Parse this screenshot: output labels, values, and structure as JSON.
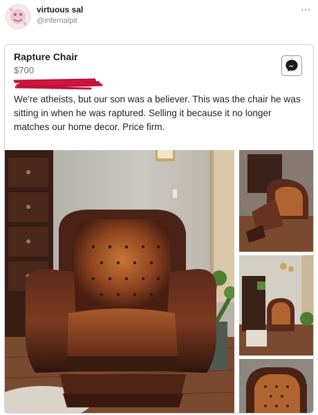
{
  "post": {
    "display_name": "virtuous sal",
    "handle": "@infernalpit",
    "more_icon": "more-horizontal-icon",
    "more_label": "..."
  },
  "listing": {
    "title": "Rapture Chair",
    "price": "$700",
    "description": "We're atheists, but our son was a believer. This was the chair he was sitting in when he was raptured. Selling it because it no longer matches our home decor. Price firm.",
    "messenger_icon": "messenger-icon",
    "photo_count": 4
  },
  "colors": {
    "leather": "#5a2a1c",
    "leather_highlight": "#b0642f",
    "wall": "#c9c5bd",
    "floor": "#7a4a30",
    "redaction": "#c21038"
  }
}
